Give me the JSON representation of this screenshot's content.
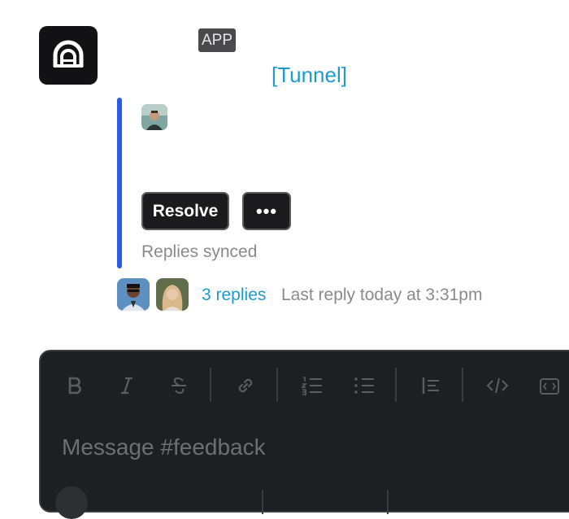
{
  "message": {
    "app_badge": "APP",
    "link_text": "[Tunnel]"
  },
  "actions": {
    "resolve_label": "Resolve",
    "more_label": "•••"
  },
  "status": {
    "synced_text": "Replies synced"
  },
  "thread": {
    "replies_count": "3 replies",
    "last_reply": "Last reply today at 3:31pm"
  },
  "composer": {
    "placeholder": "Message #feedback",
    "toolbar_icons": [
      "bold-icon",
      "italic-icon",
      "strikethrough-icon",
      "link-icon",
      "ordered-list-icon",
      "bullet-list-icon",
      "blockquote-icon",
      "code-icon",
      "code-block-icon"
    ]
  },
  "colors": {
    "link": "#1d9bd1",
    "quote_bar": "#2b5ce6",
    "composer_bg": "#1e1f22"
  }
}
